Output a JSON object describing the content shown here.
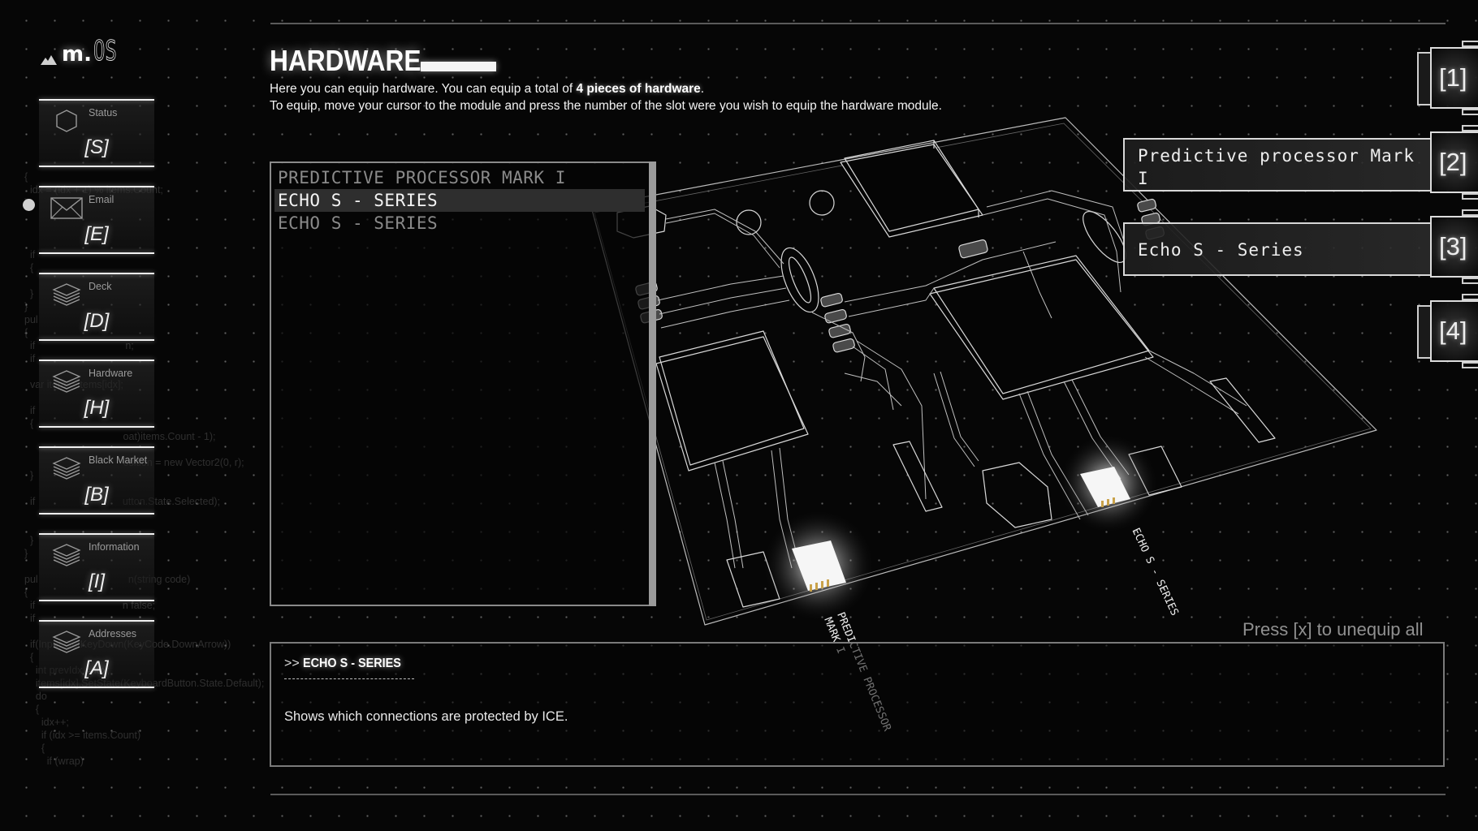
{
  "app": {
    "logo_text": "m.",
    "logo_suffix": "OS"
  },
  "sidebar": {
    "items": [
      {
        "label": "Status",
        "key": "[S]",
        "icon": "hexagon-icon"
      },
      {
        "label": "Email",
        "key": "[E]",
        "icon": "envelope-icon"
      },
      {
        "label": "Deck",
        "key": "[D]",
        "icon": "layers-icon"
      },
      {
        "label": "Hardware",
        "key": "[H]",
        "icon": "layers-icon"
      },
      {
        "label": "Black Market",
        "key": "[B]",
        "icon": "layers-icon"
      },
      {
        "label": "Information",
        "key": "[I]",
        "icon": "layers-icon"
      },
      {
        "label": "Addresses",
        "key": "[A]",
        "icon": "layers-icon"
      }
    ],
    "active_indicator_index": 1
  },
  "background_code": [
    "{",
    "  idx = (idx + 1) % items.Count;",
    "}",
    "",
    "",
    "",
    "  if",
    "  {",
    "",
    "  }",
    "}",
    "pul",
    "{",
    "  if                                n;",
    "  if",
    "",
    "  var item = items[idx];",
    "",
    "  if",
    "  {",
    "                                   oat)items.Count - 1);",
    "",
    "                                   osition = new Vector2(0, r);",
    "  }",
    "",
    "  if                               utton.State.Selected);",
    "",
    "",
    "  }",
    "}",
    "",
    "pul                                n(string code)",
    "{",
    "  if                               n false;",
    "  if",
    "",
    "  if(Input.GetKeyDown(KeyCode.DownArrow))",
    "  {",
    "    int prevIdx = idx;",
    "    items[idx].SetState(KeyboardButton.State.Default);",
    "    do",
    "    {",
    "      idx++;",
    "      if (idx >= items.Count)",
    "      {",
    "        if (wrap)"
  ],
  "header": {
    "title": "HARDWARE",
    "intro_line1_prefix": "Here you can equip hardware. You can equip a total of ",
    "intro_line1_bold": "4 pieces of hardware",
    "intro_line1_suffix": ".",
    "intro_line2": "To equip, move your cursor to the module and press the number of the slot were you wish to equip the hardware module."
  },
  "inventory": {
    "items": [
      {
        "label": "PREDICTIVE PROCESSOR MARK I",
        "selected": false
      },
      {
        "label": "ECHO S - SERIES",
        "selected": true
      },
      {
        "label": "ECHO S - SERIES",
        "selected": false
      }
    ]
  },
  "board": {
    "labels": [
      {
        "text": "PREDICTIVE PROCESSOR\nMARK I"
      },
      {
        "text": "ECHO S - SERIES"
      }
    ]
  },
  "slots": [
    {
      "key": "[1]",
      "equipped": ""
    },
    {
      "key": "[2]",
      "equipped": "Predictive processor Mark I"
    },
    {
      "key": "[3]",
      "equipped": "Echo S - Series"
    },
    {
      "key": "[4]",
      "equipped": ""
    }
  ],
  "footer": {
    "unequip_hint": "Press [x] to unequip all"
  },
  "detail": {
    "prefix": ">> ",
    "title": "ECHO S - SERIES",
    "description": "Shows which connections are protected by ICE."
  }
}
